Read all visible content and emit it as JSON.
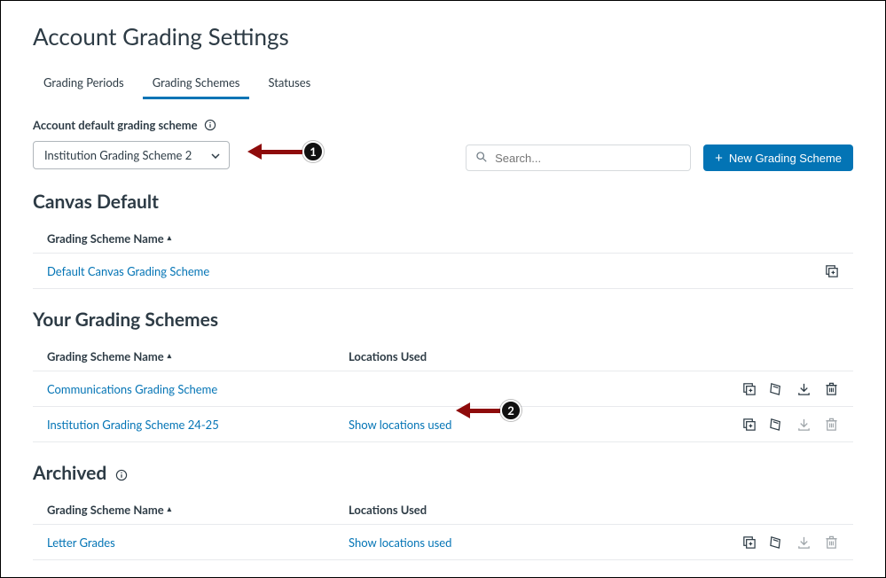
{
  "page_title": "Account Grading Settings",
  "tabs": {
    "periods": "Grading Periods",
    "schemes": "Grading Schemes",
    "statuses": "Statuses"
  },
  "default_scheme": {
    "label": "Account default grading scheme",
    "selected": "Institution Grading Scheme 2"
  },
  "search": {
    "placeholder": "Search..."
  },
  "buttons": {
    "new_scheme": "New Grading Scheme"
  },
  "columns": {
    "name": "Grading Scheme Name",
    "locations": "Locations Used"
  },
  "sections": {
    "canvas_default": {
      "title": "Canvas Default",
      "rows": [
        {
          "name": "Default Canvas Grading Scheme"
        }
      ]
    },
    "your_schemes": {
      "title": "Your Grading Schemes",
      "rows": [
        {
          "name": "Communications Grading Scheme",
          "locations": ""
        },
        {
          "name": "Institution Grading Scheme 24-25",
          "locations": "Show locations used"
        }
      ]
    },
    "archived": {
      "title": "Archived",
      "rows": [
        {
          "name": "Letter Grades",
          "locations": "Show locations used"
        }
      ]
    }
  },
  "annotations": {
    "a1": "1",
    "a2": "2"
  }
}
